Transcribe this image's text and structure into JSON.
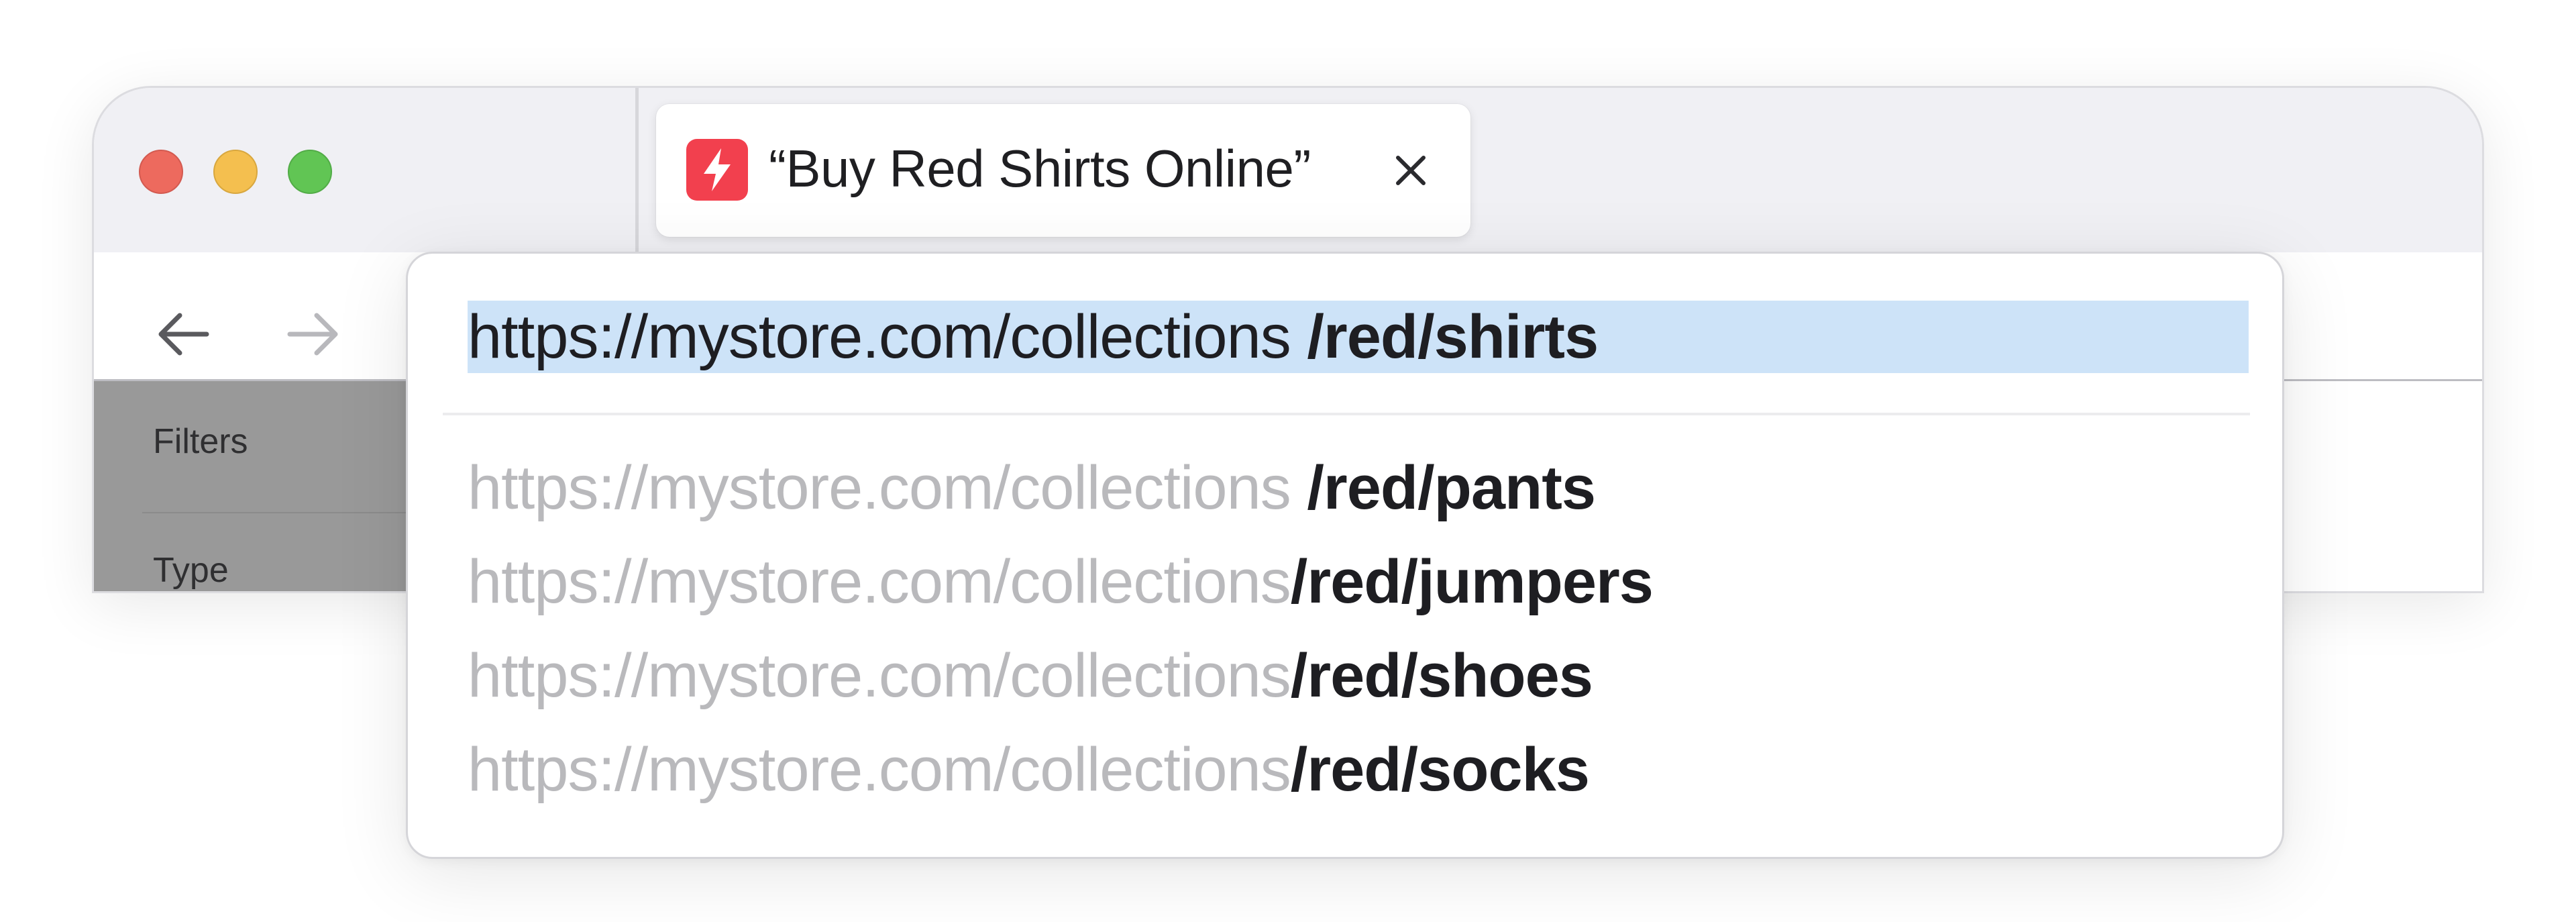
{
  "window": {
    "traffic_lights": [
      "close",
      "minimize",
      "zoom"
    ]
  },
  "tab": {
    "title": "“Buy Red Shirts Online”",
    "favicon_icon": "lightning-bolt-icon",
    "favicon_color": "#f2404e",
    "close_icon": "close-icon"
  },
  "nav": {
    "back_icon": "arrow-left-icon",
    "forward_icon": "arrow-right-icon"
  },
  "sidebar": {
    "filters_label": "Filters",
    "type_label": "Type"
  },
  "url_bar": {
    "current": {
      "base": "https://mystore.com/collections",
      "path": "/red/shirts"
    },
    "selection_color": "#cde3f8",
    "suggestions": [
      {
        "base": "https://mystore.com/collections",
        "path": "/red/pants"
      },
      {
        "base": "https://mystore.com/collections",
        "path": "/red/jumpers"
      },
      {
        "base": "https://mystore.com/collections",
        "path": "/red/shoes"
      },
      {
        "base": "https://mystore.com/collections",
        "path": "/red/socks"
      }
    ]
  }
}
